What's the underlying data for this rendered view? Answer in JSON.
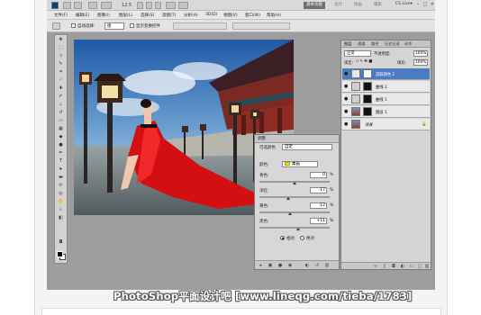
{
  "titlebar": {
    "zoom": "12.5",
    "workspaces": [
      "基本功能",
      "设计",
      "绘画",
      "摄影"
    ],
    "cslive": "CS Live▾"
  },
  "menubar": {
    "items": [
      "文件(F)",
      "编辑(E)",
      "图像(I)",
      "图层(L)",
      "选择(S)",
      "滤镜(T)",
      "分析(A)",
      "3D(D)",
      "视图(V)",
      "窗口(W)",
      "帮助(H)"
    ]
  },
  "options_bar": {
    "auto_select_label": "自动选择:",
    "auto_select_value": "组",
    "show_transform_label": "显示变换控件"
  },
  "adjustments": {
    "panel_title": "调整",
    "color_label": "可选颜色",
    "preset_value": "自定",
    "colors_label": "颜色:",
    "colors_value": "黄色",
    "sliders": [
      {
        "label": "青色:",
        "value": "0",
        "fraction": 0.5
      },
      {
        "label": "洋红:",
        "value": "-17",
        "fraction": 0.415
      },
      {
        "label": "黄色:",
        "value": "-12",
        "fraction": 0.44
      },
      {
        "label": "黑色:",
        "value": "+11",
        "fraction": 0.555
      }
    ],
    "percent": "%",
    "radio_relative": "相对",
    "radio_absolute": "绝对"
  },
  "layers": {
    "tabs": [
      "图层",
      "通道",
      "路径",
      "历史记录",
      "动作"
    ],
    "blend_mode": "正常",
    "opacity_label": "不透明度:",
    "opacity": "100%",
    "lock_label": "锁定:",
    "fill_label": "填充:",
    "fill": "100%",
    "rows": [
      {
        "name": "选取颜色 1",
        "active": true
      },
      {
        "name": "曲线 2",
        "active": false
      },
      {
        "name": "曲线 1",
        "active": false
      },
      {
        "name": "图层 1",
        "active": false
      },
      {
        "name": "背景",
        "active": false
      }
    ]
  },
  "watermark": "PhotoShop平面设计吧 [www.lineqg.com/tieba/1783]"
}
